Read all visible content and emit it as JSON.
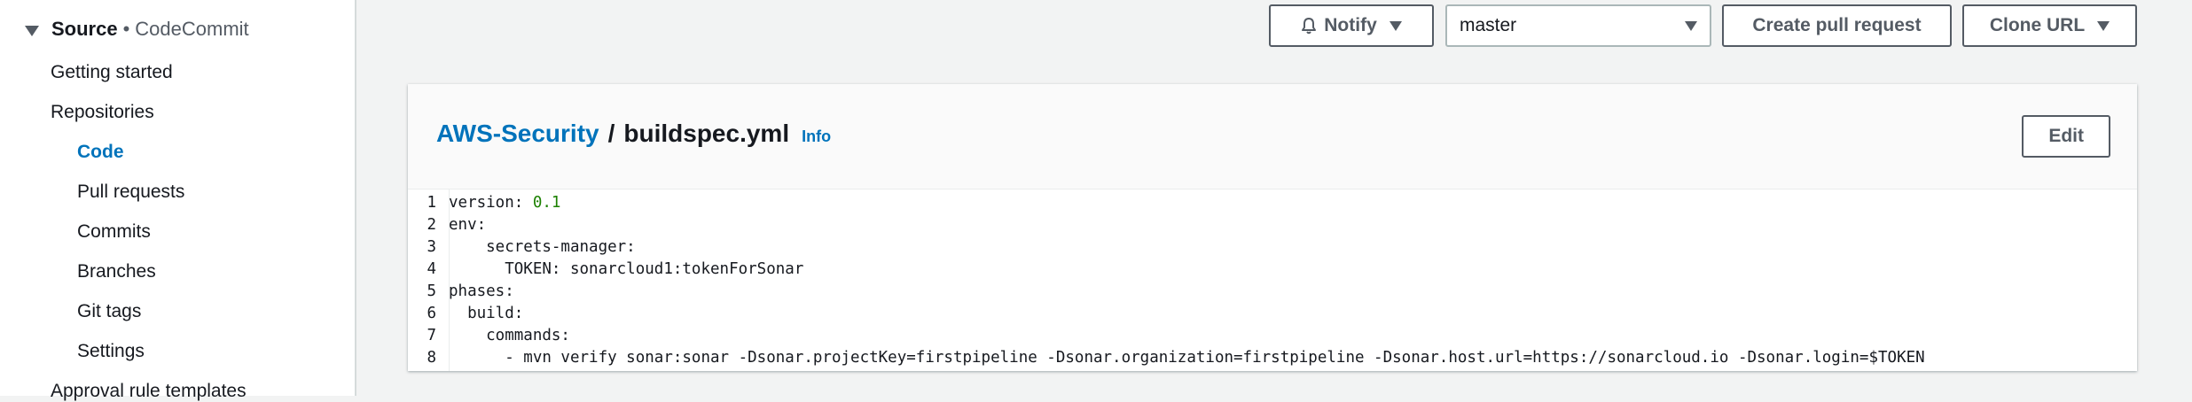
{
  "sidebar": {
    "source_label": "Source",
    "source_separator": "•",
    "source_service": "CodeCommit",
    "items": [
      {
        "label": "Getting started",
        "active": false
      },
      {
        "label": "Repositories",
        "active": false
      },
      {
        "label": "Code",
        "active": true
      },
      {
        "label": "Pull requests",
        "active": false
      },
      {
        "label": "Commits",
        "active": false
      },
      {
        "label": "Branches",
        "active": false
      },
      {
        "label": "Git tags",
        "active": false
      },
      {
        "label": "Settings",
        "active": false
      },
      {
        "label": "Approval rule templates",
        "active": false
      }
    ]
  },
  "toolbar": {
    "notify_label": "Notify",
    "branch_value": "master",
    "create_pr_label": "Create pull request",
    "clone_url_label": "Clone URL"
  },
  "panel": {
    "repo_name": "AWS-Security",
    "separator": "/",
    "file_name": "buildspec.yml",
    "info_label": "Info",
    "edit_label": "Edit"
  },
  "code": {
    "lines": [
      {
        "no": "1",
        "text": "version: ",
        "value": "0.1"
      },
      {
        "no": "2",
        "text": "env:"
      },
      {
        "no": "3",
        "text": "    secrets-manager:"
      },
      {
        "no": "4",
        "text": "      TOKEN: sonarcloud1:tokenForSonar"
      },
      {
        "no": "5",
        "text": "phases:"
      },
      {
        "no": "6",
        "text": "  build:"
      },
      {
        "no": "7",
        "text": "    commands:"
      },
      {
        "no": "8",
        "text": "      - mvn verify sonar:sonar -Dsonar.projectKey=firstpipeline -Dsonar.organization=firstpipeline -Dsonar.host.url=https://sonarcloud.io -Dsonar.login=$TOKEN"
      }
    ]
  },
  "colors": {
    "link": "#0073bb",
    "number": "#1d8102"
  }
}
